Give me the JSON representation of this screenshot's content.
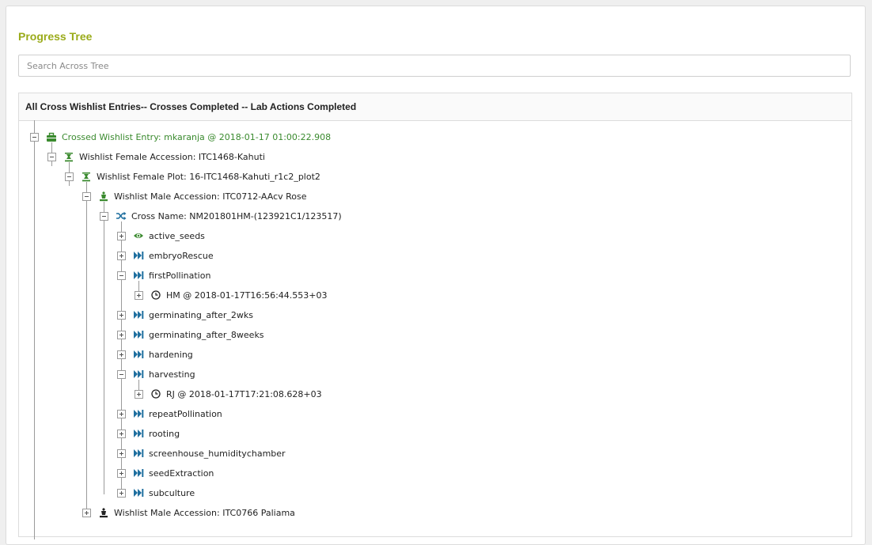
{
  "title": "Progress Tree",
  "search": {
    "placeholder": "Search Across Tree"
  },
  "tree": {
    "header": "All Cross Wishlist Entries-- Crosses Completed -- Lab Actions Completed",
    "nodes": [
      {
        "label": "Crossed Wishlist Entry: mkaranja @ 2018-01-17 01:00:22.908",
        "icon": "briefcase-icon"
      },
      {
        "label": "Wishlist Female Accession: ITC1468-Kahuti",
        "icon": "female-accession-icon"
      },
      {
        "label": "Wishlist Female Plot: 16-ITC1468-Kahuti_r1c2_plot2",
        "icon": "female-plot-icon"
      },
      {
        "label": "Wishlist Male Accession: ITC0712-AAcv Rose",
        "icon": "male-accession-icon"
      },
      {
        "label": "Cross Name: NM201801HM-(123921C1/123517)",
        "icon": "shuffle-icon"
      },
      {
        "label": "active_seeds",
        "icon": "eye-icon"
      },
      {
        "label": "embryoRescue",
        "icon": "fast-forward-icon"
      },
      {
        "label": "firstPollination",
        "icon": "fast-forward-icon"
      },
      {
        "label": "HM @ 2018-01-17T16:56:44.553+03",
        "icon": "clock-icon"
      },
      {
        "label": "germinating_after_2wks",
        "icon": "fast-forward-icon"
      },
      {
        "label": "germinating_after_8weeks",
        "icon": "fast-forward-icon"
      },
      {
        "label": "hardening",
        "icon": "fast-forward-icon"
      },
      {
        "label": "harvesting",
        "icon": "fast-forward-icon"
      },
      {
        "label": "RJ @ 2018-01-17T17:21:08.628+03",
        "icon": "clock-icon"
      },
      {
        "label": "repeatPollination",
        "icon": "fast-forward-icon"
      },
      {
        "label": "rooting",
        "icon": "fast-forward-icon"
      },
      {
        "label": "screenhouse_humiditychamber",
        "icon": "fast-forward-icon"
      },
      {
        "label": "seedExtraction",
        "icon": "fast-forward-icon"
      },
      {
        "label": "subculture",
        "icon": "fast-forward-icon"
      },
      {
        "label": "Wishlist Male Accession: ITC0766 Paliama",
        "icon": "male-accession-icon"
      }
    ]
  },
  "colors": {
    "title": "#9aab1a",
    "node_green": "#3a8a2e",
    "icon_blue": "#1f6f9f",
    "icon_dark": "#222222"
  }
}
